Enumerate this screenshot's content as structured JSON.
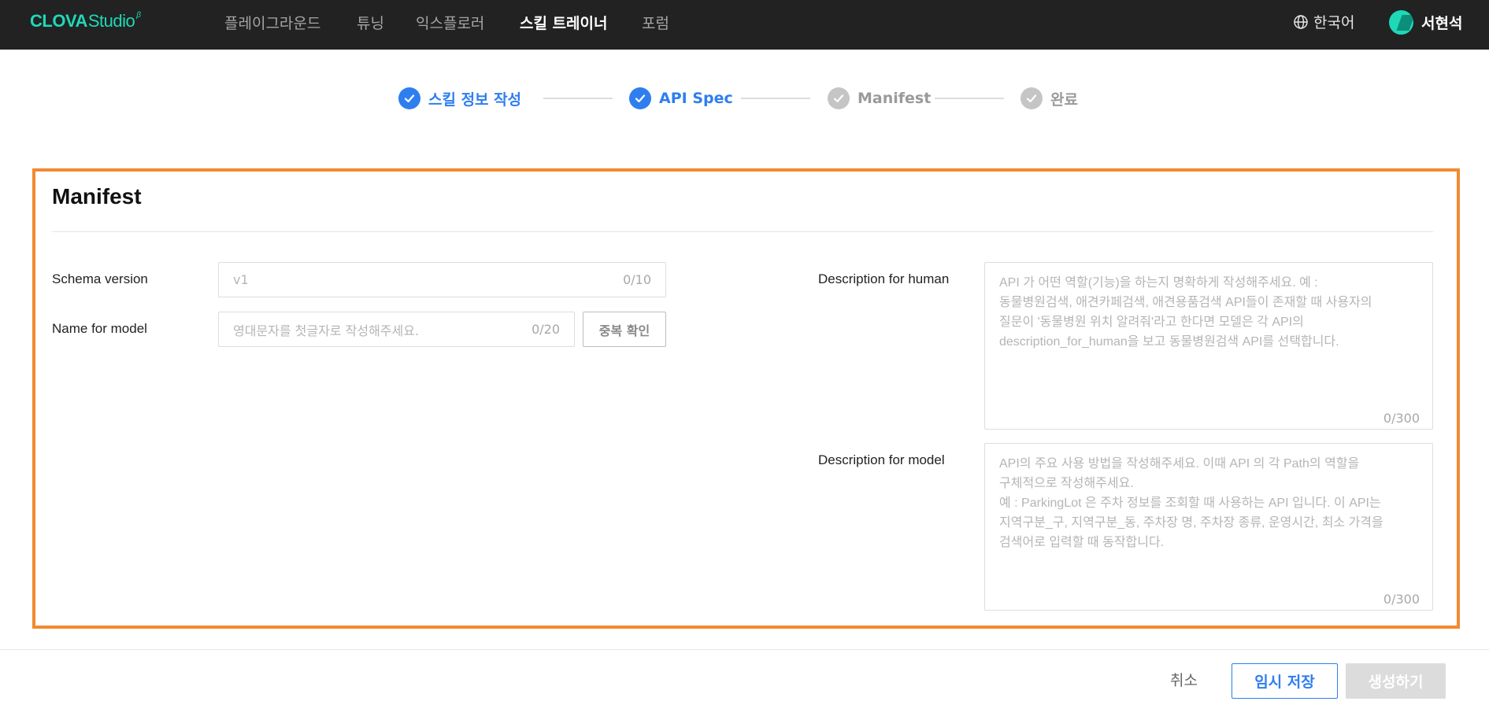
{
  "header": {
    "logo_main": "CLOVA",
    "logo_sub": "Studio",
    "logo_beta": "β",
    "nav": [
      "플레이그라운드",
      "튜닝",
      "익스플로러",
      "스킬 트레이너",
      "포럼"
    ],
    "active_nav": "스킬 트레이너",
    "language": "한국어",
    "user_name": "서현석",
    "icons": {
      "language": "globe-icon",
      "user": "avatar"
    }
  },
  "stepper": {
    "steps": [
      {
        "label": "스킬 정보 작성",
        "state": "done"
      },
      {
        "label": "API Spec",
        "state": "done"
      },
      {
        "label": "Manifest",
        "state": "todo"
      },
      {
        "label": "완료",
        "state": "todo"
      }
    ]
  },
  "manifest": {
    "title": "Manifest",
    "schema_version": {
      "label": "Schema version",
      "value": "v1",
      "count": "0/10"
    },
    "name_for_model": {
      "label": "Name for model",
      "placeholder": "영대문자를 첫글자로 작성해주세요.",
      "count": "0/20",
      "dup_button": "중복 확인"
    },
    "description_for_human": {
      "label": "Description for human",
      "placeholder": "API 가 어떤 역할(기능)을 하는지 명확하게 작성해주세요. 예 :\n동물병원검색, 애견카페검색, 애견용품검색 API들이 존재할 때 사용자의\n질문이 '동물병원 위치 알려줘'라고 한다면 모델은 각 API의\ndescription_for_human을 보고 동물병원검색 API를 선택합니다.",
      "count": "0/300"
    },
    "description_for_model": {
      "label": "Description for model",
      "placeholder": "API의 주요 사용 방법을 작성해주세요. 이때 API 의 각 Path의 역할을\n구체적으로 작성해주세요.\n예 : ParkingLot 은 주차 정보를 조회할 때 사용하는 API 입니다. 이 API는\n지역구분_구, 지역구분_동, 주차장 명, 주차장 종류, 운영시간, 최소 가격을\n검색어로 입력할 때 동작합니다.",
      "count": "0/300"
    }
  },
  "footer": {
    "cancel": "취소",
    "temp_save": "임시 저장",
    "create": "생성하기"
  },
  "colors": {
    "accent": "#2e7ef0",
    "highlight_border": "#f28a30",
    "brand": "#1fd8b7",
    "topbar": "#222222"
  }
}
